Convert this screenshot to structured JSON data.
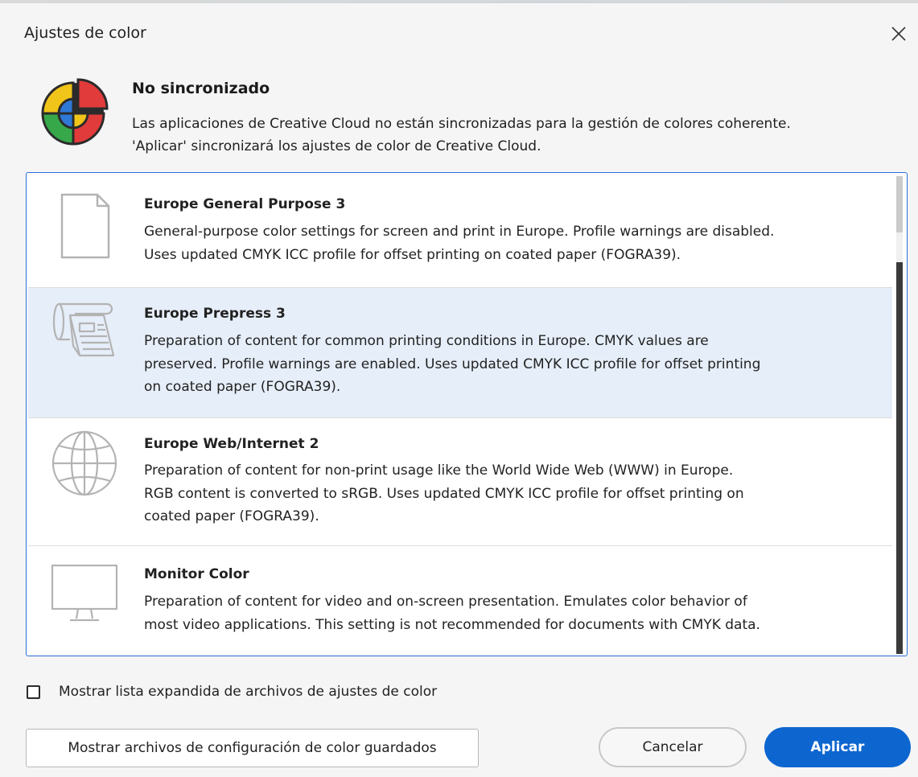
{
  "dialog": {
    "title": "Ajustes de color",
    "close_icon": "close-icon"
  },
  "status": {
    "icon": "color-wheel-icon",
    "title": "No sincronizado",
    "description_line1": "Las aplicaciones de Creative Cloud no están sincronizadas para la gestión de colores coherente.",
    "description_line2": "'Aplicar' sincronizará los ajustes de color de Creative Cloud."
  },
  "settings_list": {
    "items": [
      {
        "icon": "document-icon",
        "title": "Europe General Purpose 3",
        "description": [
          "General-purpose color settings for screen and print in Europe. Profile warnings are disabled.",
          "Uses updated CMYK ICC profile for offset printing on coated paper (FOGRA39)."
        ],
        "selected": false
      },
      {
        "icon": "printing-press-icon",
        "title": "Europe Prepress 3",
        "description": [
          "Preparation of content for common printing conditions in Europe. CMYK values are",
          "preserved. Profile warnings are enabled. Uses updated CMYK ICC profile for offset printing",
          "on coated paper (FOGRA39)."
        ],
        "selected": true
      },
      {
        "icon": "globe-icon",
        "title": "Europe Web/Internet 2",
        "description": [
          "Preparation of content for non-print usage like the World Wide Web (WWW) in Europe.",
          "RGB content is converted to sRGB. Uses updated CMYK ICC profile for offset printing on",
          "coated paper (FOGRA39)."
        ],
        "selected": false
      },
      {
        "icon": "monitor-icon",
        "title": "Monitor Color",
        "description": [
          "Preparation of content for video and on-screen presentation. Emulates color behavior of",
          "most video applications. This setting is not recommended for documents with CMYK data."
        ],
        "selected": false
      }
    ]
  },
  "options": {
    "expanded_list_label": "Mostrar lista expandida de archivos de ajustes de color",
    "expanded_list_checked": false
  },
  "buttons": {
    "show_saved": "Mostrar archivos de configuración de color guardados",
    "cancel": "Cancelar",
    "apply": "Aplicar"
  },
  "colors": {
    "accent": "#0d66d0",
    "selection": "#e6eef9",
    "list_border": "#2a6dd6"
  }
}
